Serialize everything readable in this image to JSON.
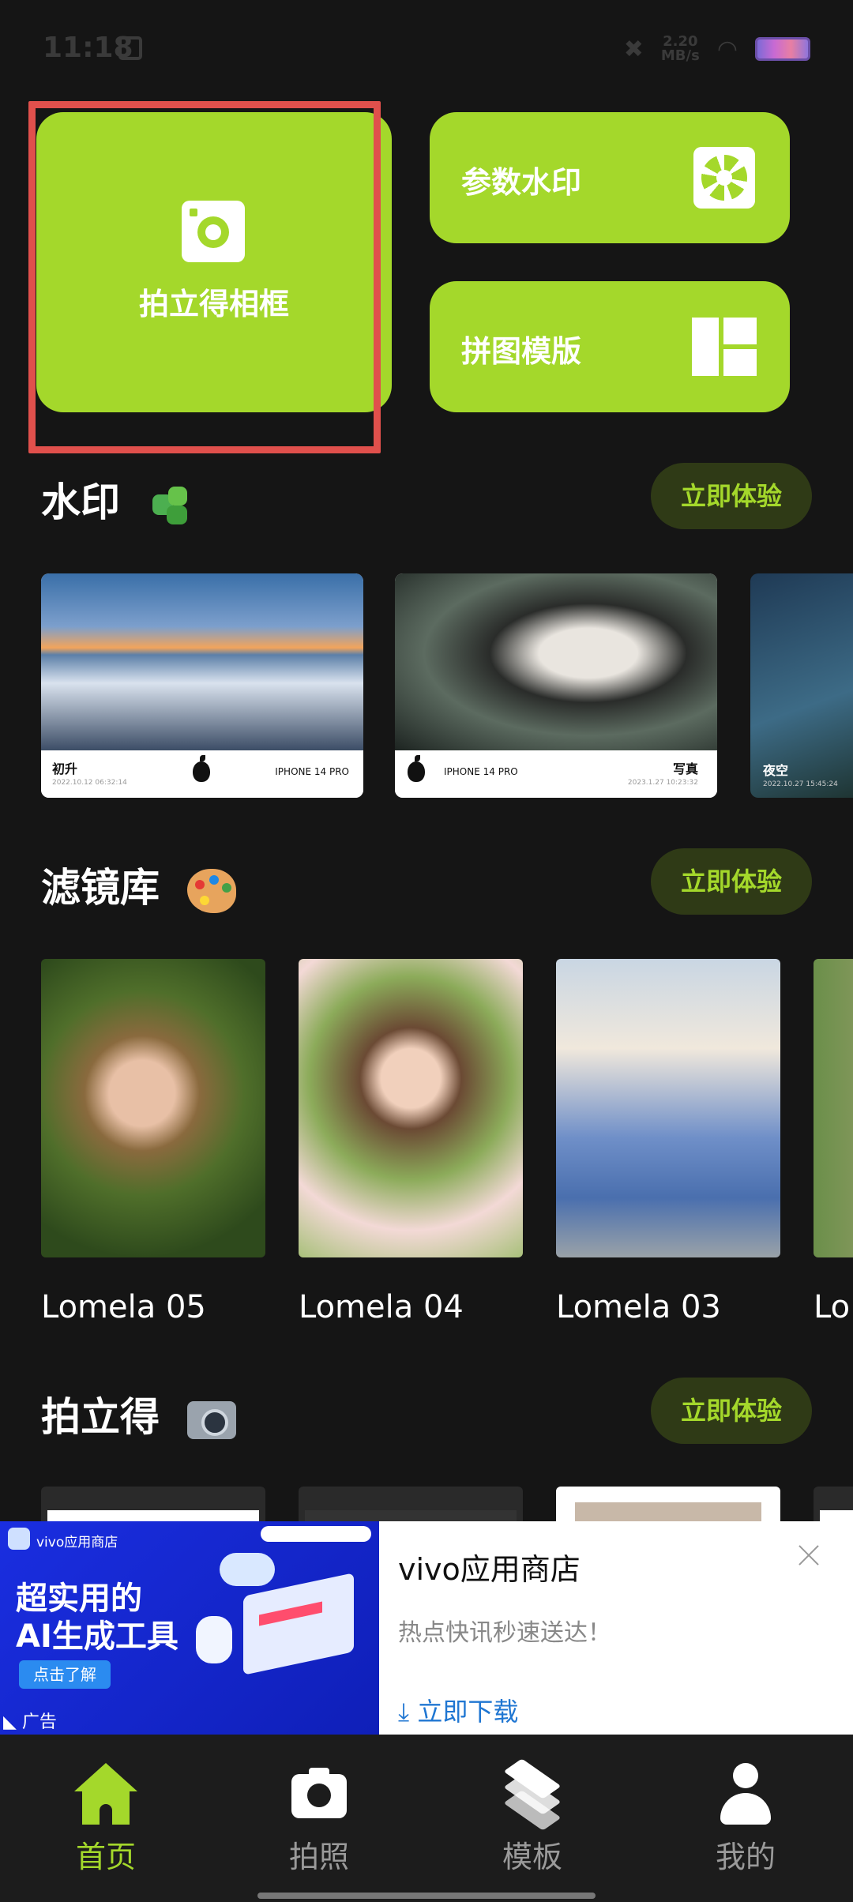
{
  "status_bar": {
    "time": "11:18",
    "speed_value": "2.20",
    "speed_unit": "MB/s"
  },
  "tiles": {
    "polaroid_frame": "拍立得相框",
    "param_watermark": "参数水印",
    "collage_template": "拼图模版"
  },
  "sections": {
    "watermark": {
      "title": "水印",
      "cta": "立即体验",
      "cards": [
        {
          "place": "初升",
          "date": "2022.10.12 06:32:14",
          "device": "IPHONE 14 PRO"
        },
        {
          "place": "写真",
          "date": "2023.1.27 10:23:32",
          "device": "IPHONE 14 PRO"
        },
        {
          "place": "夜空",
          "date": "2022.10.27 15:45:24",
          "device": ""
        }
      ]
    },
    "filters": {
      "title": "滤镜库",
      "cta": "立即体验",
      "items": [
        {
          "name": "Lomela 05"
        },
        {
          "name": "Lomela 04"
        },
        {
          "name": "Lomela 03"
        },
        {
          "name": "Lo"
        }
      ]
    },
    "polaroid": {
      "title": "拍立得",
      "cta": "立即体验"
    }
  },
  "ad": {
    "store_name": "vivo应用商店",
    "headline_line1": "超实用的",
    "headline_line2": "AI生成工具",
    "learn_more": "点击了解",
    "ad_label": "广告",
    "title": "vivo应用商店",
    "description": "热点快讯秒速送达！",
    "download": "立即下载"
  },
  "tabbar": {
    "items": [
      {
        "label": "首页",
        "active": true
      },
      {
        "label": "拍照",
        "active": false
      },
      {
        "label": "模板",
        "active": false
      },
      {
        "label": "我的",
        "active": false
      }
    ]
  },
  "colors": {
    "accent": "#a4d82b",
    "background": "#151515",
    "cta_bg": "#2f3a16",
    "highlight": "#e0504c",
    "ad_link": "#1f76d2"
  }
}
